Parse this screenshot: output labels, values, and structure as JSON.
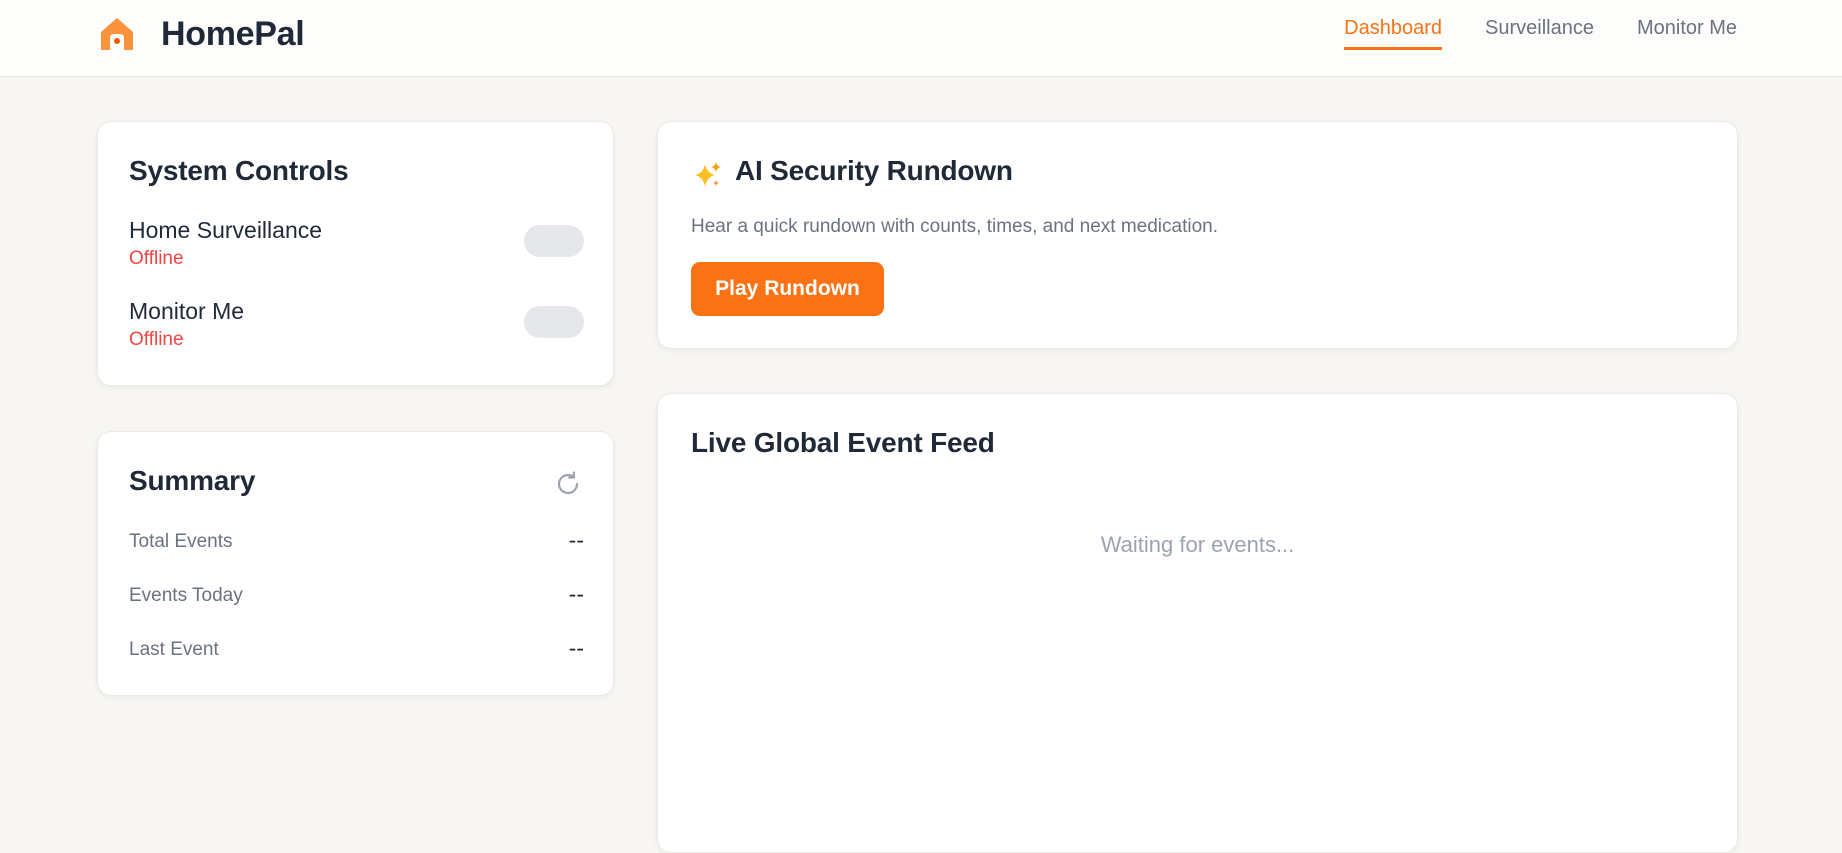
{
  "app": {
    "name": "HomePal",
    "accent_color": "#f97316",
    "logo_icon": "home-icon"
  },
  "nav": {
    "items": [
      {
        "label": "Dashboard",
        "active": true
      },
      {
        "label": "Surveillance",
        "active": false
      },
      {
        "label": "Monitor Me",
        "active": false
      }
    ]
  },
  "system_controls": {
    "title": "System Controls",
    "items": [
      {
        "name": "Home Surveillance",
        "status": "Offline",
        "enabled": false
      },
      {
        "name": "Monitor Me",
        "status": "Offline",
        "enabled": false
      }
    ],
    "status_color": "#ef4444"
  },
  "summary": {
    "title": "Summary",
    "refresh_icon": "refresh-icon",
    "rows": [
      {
        "label": "Total Events",
        "value": "--"
      },
      {
        "label": "Events Today",
        "value": "--"
      },
      {
        "label": "Last Event",
        "value": "--"
      }
    ]
  },
  "rundown": {
    "icon": "sparkles-icon",
    "title": "AI Security Rundown",
    "description": "Hear a quick rundown with counts, times, and next medication.",
    "button_label": "Play Rundown"
  },
  "feed": {
    "title": "Live Global Event Feed",
    "empty_text": "Waiting for events..."
  }
}
